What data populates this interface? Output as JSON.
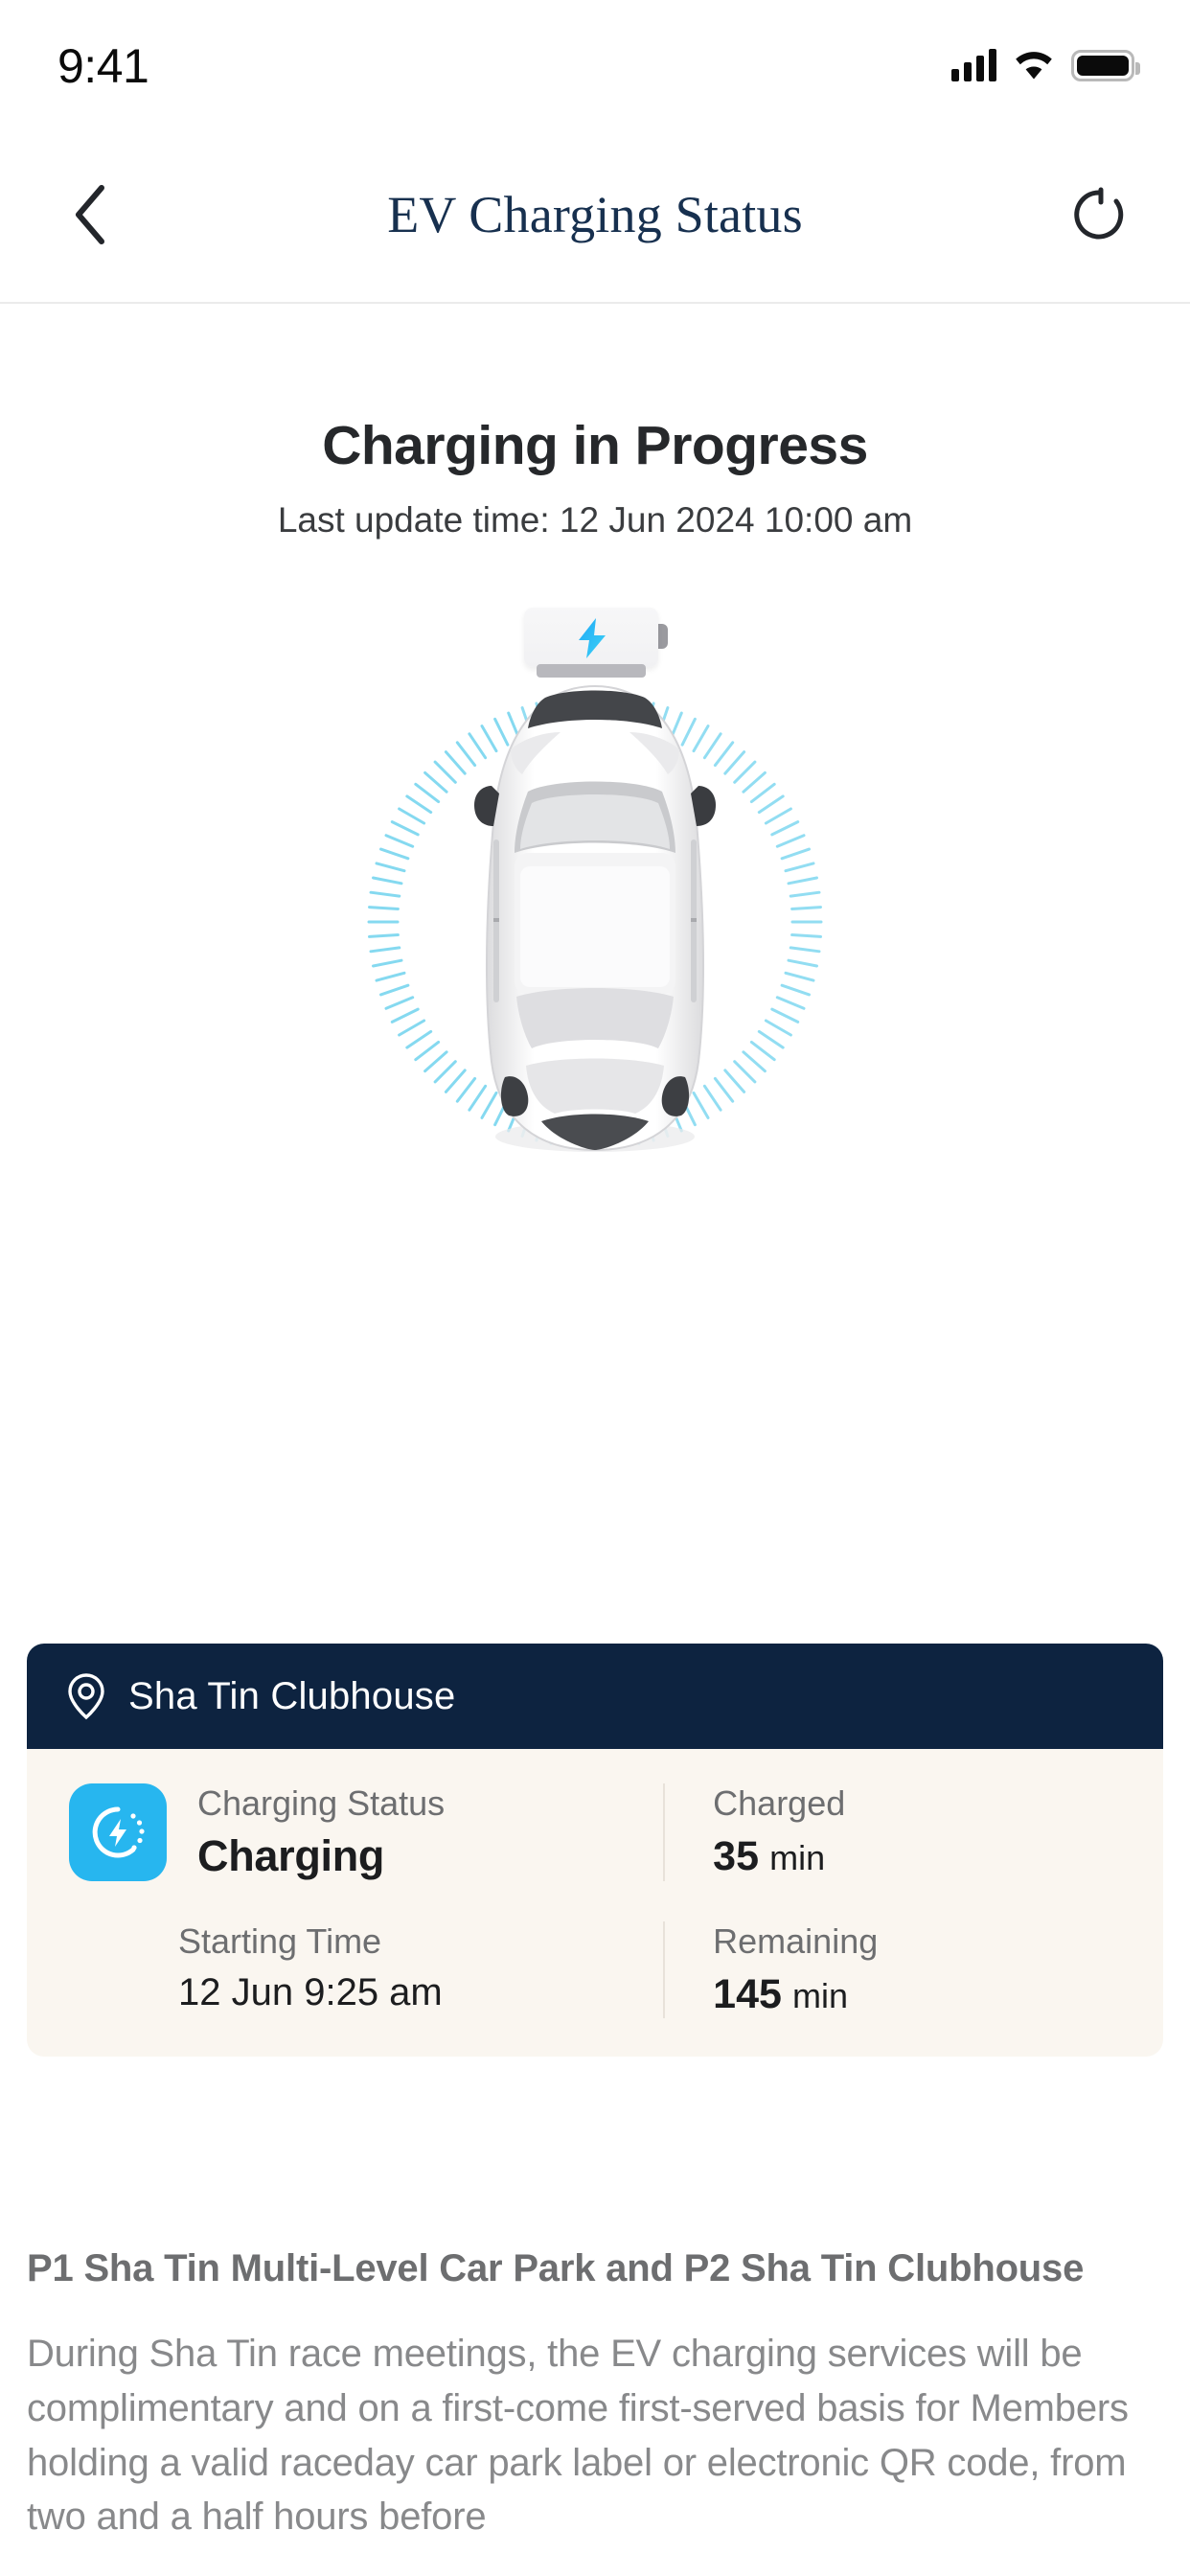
{
  "status_bar": {
    "time": "9:41",
    "signal_icon": "cellular-signal-icon",
    "wifi_icon": "wifi-icon",
    "battery_icon": "battery-full-icon"
  },
  "nav": {
    "back_icon": "chevron-left-icon",
    "title": "EV Charging Status",
    "refresh_icon": "refresh-icon"
  },
  "hero": {
    "title": "Charging in Progress",
    "subtitle": "Last update time: 12 Jun 2024 10:00 am",
    "battery_illustration": "battery-charging-icon",
    "bolt_icon": "lightning-bolt-icon",
    "car_illustration": "electric-car-top-view"
  },
  "card": {
    "location_pin_icon": "location-pin-icon",
    "location": "Sha Tin Clubhouse",
    "status_icon": "charging-status-icon",
    "fields": [
      {
        "label": "Charging Status",
        "value": "Charging",
        "unit": ""
      },
      {
        "label": "Charged",
        "value": "35",
        "unit": "min"
      },
      {
        "label": "Starting Time",
        "value": "12 Jun 9:25 am",
        "unit": ""
      },
      {
        "label": "Remaining",
        "value": "145",
        "unit": "min"
      }
    ]
  },
  "footer": {
    "heading": "P1 Sha Tin Multi-Level Car Park and P2 Sha Tin Clubhouse",
    "body": "During Sha Tin race meetings, the EV charging services will be complimentary and on a first-come first-served basis for Members holding a valid raceday car park label or electronic QR code, from two and a half hours before"
  },
  "colors": {
    "navy": "#0d2340",
    "cream": "#faf6f0",
    "cyan": "#27b6ef",
    "ray_blue": "#7fd8f0"
  }
}
